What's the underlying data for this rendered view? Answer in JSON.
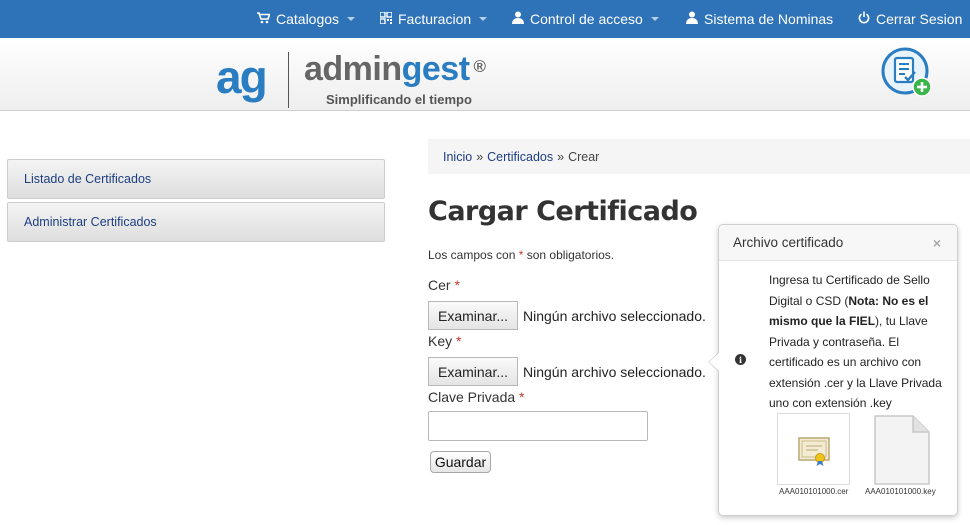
{
  "nav": {
    "catalogos": "Catalogos",
    "facturacion": "Facturacion",
    "control_acceso": "Control de acceso",
    "nominas": "Sistema de Nominas",
    "cerrar": "Cerrar Sesion"
  },
  "logo": {
    "mark": "ag",
    "name_a": "admin",
    "name_b": "gest",
    "reg": "®",
    "tagline": "Simplificando el tiempo"
  },
  "sidebar": {
    "items": [
      {
        "label": "Listado de Certificados"
      },
      {
        "label": "Administrar Certificados"
      }
    ]
  },
  "breadcrumb": {
    "inicio": "Inicio",
    "sep": "»",
    "certificados": "Certificados",
    "crear": "Crear"
  },
  "page": {
    "title": "Cargar Certificado",
    "required_note_a": "Los campos con",
    "required_mark": "*",
    "required_note_b": "son obligatorios."
  },
  "form": {
    "cer_label": "Cer",
    "key_label": "Key",
    "clave_label": "Clave Privada",
    "browse_label": "Examinar...",
    "no_file": "Ningún archivo seleccionado.",
    "clave_value": "",
    "submit_label": "Guardar"
  },
  "popover": {
    "title": "Archivo certificado",
    "close": "×",
    "info": "i",
    "text_a": "Ingresa tu Certificado de Sello Digital o CSD (",
    "text_bold": "Nota: No es el mismo que la FIEL",
    "text_b": "), tu Llave Privada y contraseña. El certificado es un archivo con extensión .cer y la Llave Privada uno con extensión .key",
    "file_cer": "AAA010101000.cer",
    "file_key": "AAA010101000.key"
  },
  "colors": {
    "nav_bg": "#2e72b8",
    "brand_blue": "#2a7dc0",
    "link": "#1d3e80",
    "required": "#c0392b"
  }
}
